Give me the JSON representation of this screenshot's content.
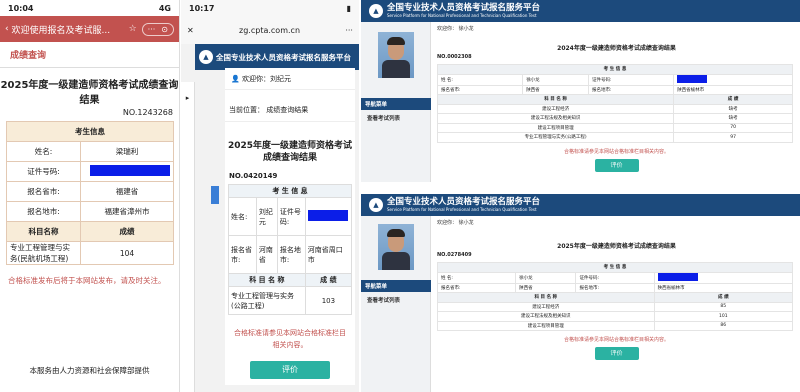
{
  "panel1": {
    "status_time": "10:04",
    "status_signal": "4G",
    "title": "欢迎使用报名及考试服...",
    "section": "成绩查询",
    "result_title": "2025年度一级建造师资格考试成绩查询结果",
    "no": "NO.1243268",
    "info_header": "考生信息",
    "fields": [
      {
        "label": "姓名:",
        "value": "梁瑞利"
      },
      {
        "label": "证件号码:",
        "value": ""
      },
      {
        "label": "报名省市:",
        "value": "福建省"
      },
      {
        "label": "报名地市:",
        "value": "福建省漳州市"
      }
    ],
    "subject_header": "科目名称",
    "score_header": "成绩",
    "scores": [
      {
        "subject": "专业工程管理与实务(民航机场工程)",
        "score": "104"
      }
    ],
    "note": "合格标准发布后将于本网站发布，请及时关注。",
    "footer": "本服务由人力资源和社会保障部提供"
  },
  "panel2": {
    "status_time": "10:17",
    "url": "zg.cpta.com.cn",
    "header": "全国专业技术人员资格考试报名服务平台",
    "welcome": "欢迎你：刘纪元",
    "location": "当前位置：  成绩查询结果",
    "result_title_1": "2025年度一级建造师资格考试",
    "result_title_2": "成绩查询结果",
    "no": "NO.0420149",
    "info_header": "考 生 信 息",
    "name_label": "姓名:",
    "name_value": "刘纪元",
    "id_label": "证件号码:",
    "prov_label": "报名省市:",
    "prov_value": "河南省",
    "city_label": "报名地市:",
    "city_value": "河南省周口市",
    "subject_header": "科 目 名 称",
    "score_header": "成 绩",
    "scores": [
      {
        "subject": "专业工程管理与实务(公路工程)",
        "score": "103"
      }
    ],
    "note": "合格标准请参见本网站合格标准栏目相关内容。",
    "button": "评价"
  },
  "panel3": {
    "header": "全国专业技术人员资格考试报名服务平台",
    "header_sub": "Service Platform for National Professional and Technician Qualification Test",
    "welcome": "欢迎你：  徐小龙",
    "menu_main": "导航菜单",
    "menu_item": "查看考试列表",
    "result_title": "2024年度一级建造师资格考试成绩查询结果",
    "no": "NO.0002308",
    "info_header": "考 生 信 息",
    "name_label": "姓    名:",
    "name_value": "徐小龙",
    "id_label": "证件号码:",
    "prov_label": "报名省市:",
    "prov_value": "陕西省",
    "city_label": "报名地市:",
    "city_value": "陕西省榆林市",
    "subject_header": "科 目 名 称",
    "score_header": "成 绩",
    "scores": [
      {
        "subject": "建设工程经济",
        "score": "缺考"
      },
      {
        "subject": "建设工程法规及相关知识",
        "score": "缺考"
      },
      {
        "subject": "建设工程项目管理",
        "score": "70"
      },
      {
        "subject": "专业工程管理与实务(公路工程)",
        "score": "97"
      }
    ],
    "note": "合格标准请参见本网站合格标准栏目相关内容。",
    "button": "评价"
  },
  "panel4": {
    "header": "全国专业技术人员资格考试报名服务平台",
    "header_sub": "Service Platform for National Professional and Technician Qualification Test",
    "welcome": "欢迎你：  徐小龙",
    "menu_main": "导航菜单",
    "menu_item": "查看考试列表",
    "result_title": "2025年度一级建造师资格考试成绩查询结果",
    "no": "NO.0278409",
    "info_header": "考 生 信 息",
    "name_label": "姓    名:",
    "name_value": "徐小龙",
    "id_label": "证件号码:",
    "prov_label": "报名省市:",
    "prov_value": "陕西省",
    "city_label": "报名地市:",
    "city_value": "陕西省榆林市",
    "subject_header": "科 目 名 称",
    "score_header": "成 绩",
    "scores": [
      {
        "subject": "建设工程经济",
        "score": "85"
      },
      {
        "subject": "建设工程法规及相关知识",
        "score": "101"
      },
      {
        "subject": "建设工程项目管理",
        "score": "86"
      }
    ],
    "note": "合格标准请参见本网站合格标准栏目相关内容。",
    "button": "评价"
  },
  "colors": {
    "wechat_red": "#c2524f",
    "header_blue": "#1c4a7c",
    "teal_button": "#2bb2a2",
    "mask_blue": "#0b1ee8"
  }
}
